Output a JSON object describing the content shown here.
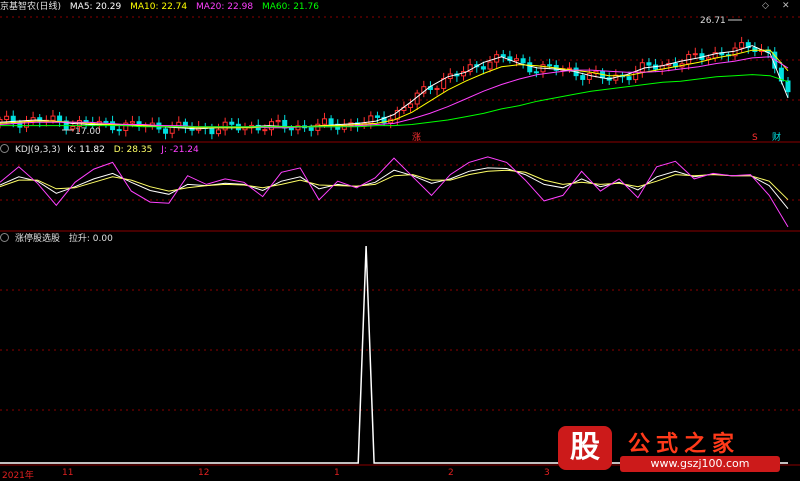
{
  "panel1": {
    "stock_name": "京基智农(日线)",
    "ma5_label": "MA5: 20.29",
    "ma10_label": "MA10: 22.74",
    "ma20_label": "MA20: 22.98",
    "ma60_label": "MA60: 21.76",
    "high_label": "26.71",
    "low_label": "17.00",
    "zhang_label": "涨",
    "mark_s_label": "S",
    "cai_label": "财"
  },
  "panel2": {
    "name_label": "KDJ(9,3,3)",
    "k_label": "K: 11.82",
    "d_label": "D: 28.35",
    "j_label": "J: -21.24"
  },
  "panel3": {
    "name_label": "涨停股选股",
    "lashen_label": "拉升: 0.00"
  },
  "controls": {
    "up_glyph": "◇",
    "close_glyph": "✕"
  },
  "x_axis": {
    "ticks": [
      {
        "label": "2021年"
      },
      {
        "label": "11"
      },
      {
        "label": "12"
      },
      {
        "label": "1"
      },
      {
        "label": "2"
      },
      {
        "label": "3"
      }
    ]
  },
  "logo": {
    "mark": "股",
    "text": "公式之家",
    "url": "www.gszj100.com"
  },
  "colors": {
    "up": "#ff3030",
    "down": "#00e0e0",
    "ma5": "#ffffff",
    "ma10": "#ffff00",
    "ma20": "#ff40ff",
    "ma60": "#00ff00",
    "k": "#ffffff",
    "d": "#ffff66",
    "j": "#ff40ff",
    "grid": "#8b0000",
    "signal": "#ffffff"
  },
  "chart_data": [
    {
      "type": "line",
      "panel": "price",
      "ylim": [
        16.5,
        27.5
      ],
      "series": [
        {
          "name": "MA5",
          "values": [
            18.1,
            18.2,
            18.3,
            18.2,
            18.0,
            17.9,
            17.9,
            17.8,
            17.8,
            17.7,
            17.6,
            17.5,
            17.6,
            17.6,
            17.7,
            17.8,
            17.7,
            17.7,
            17.8,
            17.9,
            18.0,
            18.2,
            18.8,
            20.0,
            21.3,
            22.2,
            22.6,
            23.5,
            24.0,
            23.4,
            23.0,
            22.9,
            22.7,
            22.3,
            22.0,
            22.4,
            23.0,
            23.2,
            23.6,
            23.9,
            24.3,
            24.5,
            25.0,
            24.3,
            20.29
          ]
        },
        {
          "name": "MA10",
          "values": [
            18.0,
            18.1,
            18.2,
            18.2,
            18.1,
            18.0,
            17.9,
            17.9,
            17.8,
            17.8,
            17.7,
            17.6,
            17.6,
            17.6,
            17.6,
            17.7,
            17.7,
            17.7,
            17.8,
            17.8,
            17.9,
            18.0,
            18.3,
            19.0,
            20.0,
            21.0,
            21.8,
            22.5,
            23.1,
            23.3,
            23.2,
            23.0,
            22.8,
            22.6,
            22.3,
            22.3,
            22.6,
            22.9,
            23.2,
            23.5,
            23.9,
            24.2,
            24.6,
            24.6,
            22.74
          ]
        },
        {
          "name": "MA20",
          "values": [
            17.9,
            18.0,
            18.1,
            18.1,
            18.1,
            18.1,
            18.0,
            17.9,
            17.9,
            17.8,
            17.8,
            17.7,
            17.7,
            17.7,
            17.7,
            17.6,
            17.6,
            17.7,
            17.7,
            17.7,
            17.8,
            17.9,
            18.0,
            18.4,
            18.9,
            19.5,
            20.2,
            20.9,
            21.5,
            22.0,
            22.4,
            22.6,
            22.8,
            22.8,
            22.7,
            22.6,
            22.6,
            22.7,
            22.9,
            23.1,
            23.4,
            23.6,
            23.9,
            24.0,
            22.98
          ]
        },
        {
          "name": "MA60",
          "values": [
            17.8,
            17.8,
            17.8,
            17.8,
            17.8,
            17.8,
            17.8,
            17.8,
            17.7,
            17.7,
            17.7,
            17.7,
            17.7,
            17.7,
            17.7,
            17.7,
            17.7,
            17.7,
            17.7,
            17.7,
            17.7,
            17.8,
            17.8,
            17.9,
            18.1,
            18.3,
            18.6,
            18.9,
            19.3,
            19.6,
            20.0,
            20.3,
            20.6,
            20.9,
            21.1,
            21.3,
            21.5,
            21.7,
            21.8,
            22.0,
            22.2,
            22.3,
            22.4,
            22.3,
            21.76
          ]
        }
      ]
    },
    {
      "type": "line",
      "panel": "kdj",
      "ylim": [
        -25,
        115
      ],
      "series": [
        {
          "name": "K",
          "values": [
            55,
            70,
            62,
            40,
            52,
            66,
            76,
            60,
            45,
            38,
            56,
            54,
            58,
            56,
            45,
            62,
            70,
            48,
            56,
            52,
            60,
            82,
            72,
            58,
            66,
            80,
            86,
            85,
            74,
            56,
            50,
            66,
            52,
            60,
            46,
            70,
            80,
            70,
            75,
            72,
            72,
            54,
            11.82
          ]
        },
        {
          "name": "D",
          "values": [
            52,
            64,
            64,
            48,
            50,
            60,
            70,
            64,
            52,
            44,
            50,
            54,
            56,
            55,
            50,
            56,
            64,
            55,
            54,
            53,
            56,
            72,
            74,
            64,
            64,
            74,
            80,
            82,
            78,
            64,
            56,
            60,
            56,
            58,
            52,
            62,
            74,
            72,
            74,
            72,
            72,
            62,
            28.35
          ]
        },
        {
          "name": "J",
          "values": [
            60,
            88,
            58,
            18,
            60,
            84,
            96,
            44,
            24,
            22,
            72,
            56,
            66,
            60,
            34,
            78,
            86,
            28,
            62,
            50,
            68,
            104,
            70,
            36,
            74,
            96,
            106,
            96,
            64,
            26,
            36,
            80,
            44,
            66,
            32,
            88,
            98,
            66,
            76,
            72,
            74,
            36,
            -21.24
          ]
        }
      ]
    },
    {
      "type": "line",
      "panel": "signal",
      "ylim": [
        0,
        1
      ],
      "series": [
        {
          "name": "拉升",
          "values": [
            0,
            0,
            0,
            0,
            0,
            0,
            0,
            0,
            0,
            0,
            0,
            0,
            0,
            0,
            0,
            0,
            0,
            0,
            0,
            0,
            0,
            0,
            0,
            0,
            0,
            0,
            0,
            0,
            0,
            0,
            0,
            0,
            0,
            0,
            0,
            0,
            0,
            0,
            0,
            0,
            0,
            0,
            0,
            0,
            0,
            0,
            1,
            0,
            0,
            0,
            0,
            0,
            0,
            0,
            0,
            0,
            0,
            0,
            0,
            0,
            0,
            0,
            0,
            0,
            0,
            0,
            0,
            0,
            0,
            0,
            0,
            0,
            0,
            0,
            0,
            0,
            0,
            0,
            0,
            0,
            0,
            0,
            0,
            0,
            0,
            0,
            0,
            0,
            0,
            0,
            0,
            0,
            0,
            0,
            0,
            0,
            0,
            0,
            0,
            0
          ]
        }
      ]
    }
  ]
}
